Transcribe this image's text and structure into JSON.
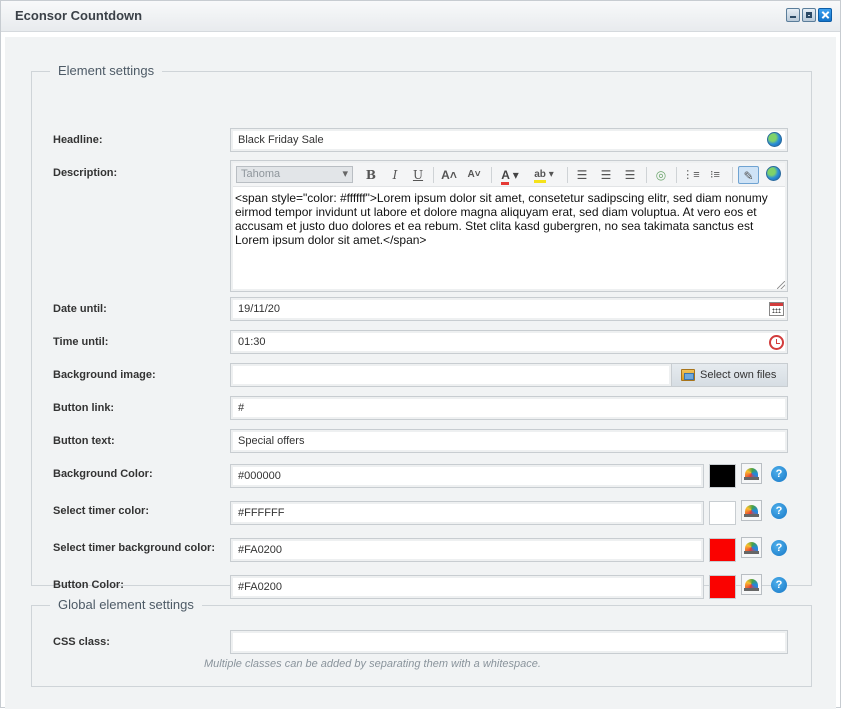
{
  "window": {
    "title": "Econsor Countdown"
  },
  "element_settings": {
    "legend": "Element settings",
    "headline": {
      "label": "Headline:",
      "value": "Black Friday Sale"
    },
    "description": {
      "label": "Description:",
      "font": "Tahoma",
      "value": "<span style=\"color: #ffffff\">Lorem ipsum dolor sit amet, consetetur sadipscing elitr, sed diam nonumy eirmod tempor invidunt ut labore et dolore magna aliquyam erat, sed diam voluptua. At vero eos et accusam et justo duo dolores et ea rebum. Stet clita kasd gubergren, no sea takimata sanctus est Lorem ipsum dolor sit amet.</span>"
    },
    "date_until": {
      "label": "Date until:",
      "value": "19/11/20"
    },
    "time_until": {
      "label": "Time until:",
      "value": "01:30"
    },
    "background_image": {
      "label": "Background image:",
      "value": "",
      "button": "Select own files"
    },
    "button_link": {
      "label": "Button link:",
      "value": "#"
    },
    "button_text": {
      "label": "Button text:",
      "value": "Special offers"
    },
    "background_color": {
      "label": "Background Color:",
      "value": "#000000",
      "swatch": "#000000"
    },
    "timer_color": {
      "label": "Select timer color:",
      "value": "#FFFFFF",
      "swatch": "#FFFFFF"
    },
    "timer_bg_color": {
      "label": "Select timer background color:",
      "value": "#FA0200",
      "swatch": "#FA0200"
    },
    "button_color": {
      "label": "Button Color:",
      "value": "#FA0200",
      "swatch": "#FA0200"
    },
    "help_glyph": "?"
  },
  "global_settings": {
    "legend": "Global element settings",
    "css_class": {
      "label": "CSS class:",
      "value": "",
      "hint": "Multiple classes can be added by separating them with a whitespace."
    }
  }
}
